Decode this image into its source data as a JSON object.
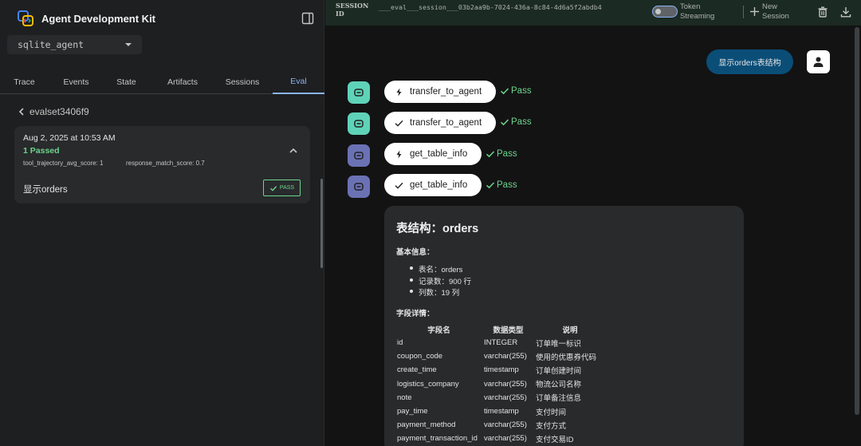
{
  "app": {
    "title": "Agent Development Kit",
    "logo_icon": "adk-logo-icon",
    "agent_select_value": "sqlite_agent"
  },
  "tabs": [
    {
      "label": "Trace",
      "active": false
    },
    {
      "label": "Events",
      "active": false
    },
    {
      "label": "State",
      "active": false
    },
    {
      "label": "Artifacts",
      "active": false
    },
    {
      "label": "Sessions",
      "active": false
    },
    {
      "label": "Eval",
      "active": true
    }
  ],
  "eval": {
    "back_label": "evalset3406f9",
    "card": {
      "date": "Aug 2, 2025 at 10:53 AM",
      "passed": "1 Passed",
      "metric_1": "tool_trajectory_avg_score: 1",
      "metric_2": "response_match_score: 0.7",
      "case_name": "显示orders",
      "badge": "PASS"
    }
  },
  "topbar": {
    "session_label": "SESSION ID",
    "session_id": "___eval___session___03b2aa9b-7024-436a-8c84-4d6a5f2abdb4",
    "token_streaming_label": "Token Streaming",
    "new_session_label": "New Session"
  },
  "chat": {
    "user_message": "显示orders表结构",
    "tool_calls": [
      {
        "name": "transfer_to_agent",
        "kind": "call",
        "status": "Pass",
        "icon_color": "#5fd3b8"
      },
      {
        "name": "transfer_to_agent",
        "kind": "response",
        "status": "Pass",
        "icon_color": "#5fd3b8"
      },
      {
        "name": "get_table_info",
        "kind": "call",
        "status": "Pass",
        "icon_color": "#6b72b4"
      },
      {
        "name": "get_table_info",
        "kind": "response",
        "status": "Pass",
        "icon_color": "#6b72b4"
      }
    ],
    "response": {
      "title": "表结构：orders",
      "basic_info_heading": "基本信息：",
      "basic_info": [
        "表名：orders",
        "记录数：900 行",
        "列数：19 列"
      ],
      "fields_heading": "字段详情：",
      "columns": [
        "字段名",
        "数据类型",
        "说明"
      ],
      "rows": [
        [
          "id",
          "INTEGER",
          "订单唯一标识"
        ],
        [
          "coupon_code",
          "varchar(255)",
          "使用的优惠券代码"
        ],
        [
          "create_time",
          "timestamp",
          "订单创建时间"
        ],
        [
          "logistics_company",
          "varchar(255)",
          "物流公司名称"
        ],
        [
          "note",
          "varchar(255)",
          "订单备注信息"
        ],
        [
          "pay_time",
          "timestamp",
          "支付时间"
        ],
        [
          "payment_method",
          "varchar(255)",
          "支付方式"
        ],
        [
          "payment_transaction_id",
          "varchar(255)",
          "支付交易ID"
        ]
      ]
    }
  },
  "colors": {
    "accent_blue": "#8ab4f8",
    "pass_green": "#6dd58c",
    "user_bubble": "#0a4e78"
  }
}
